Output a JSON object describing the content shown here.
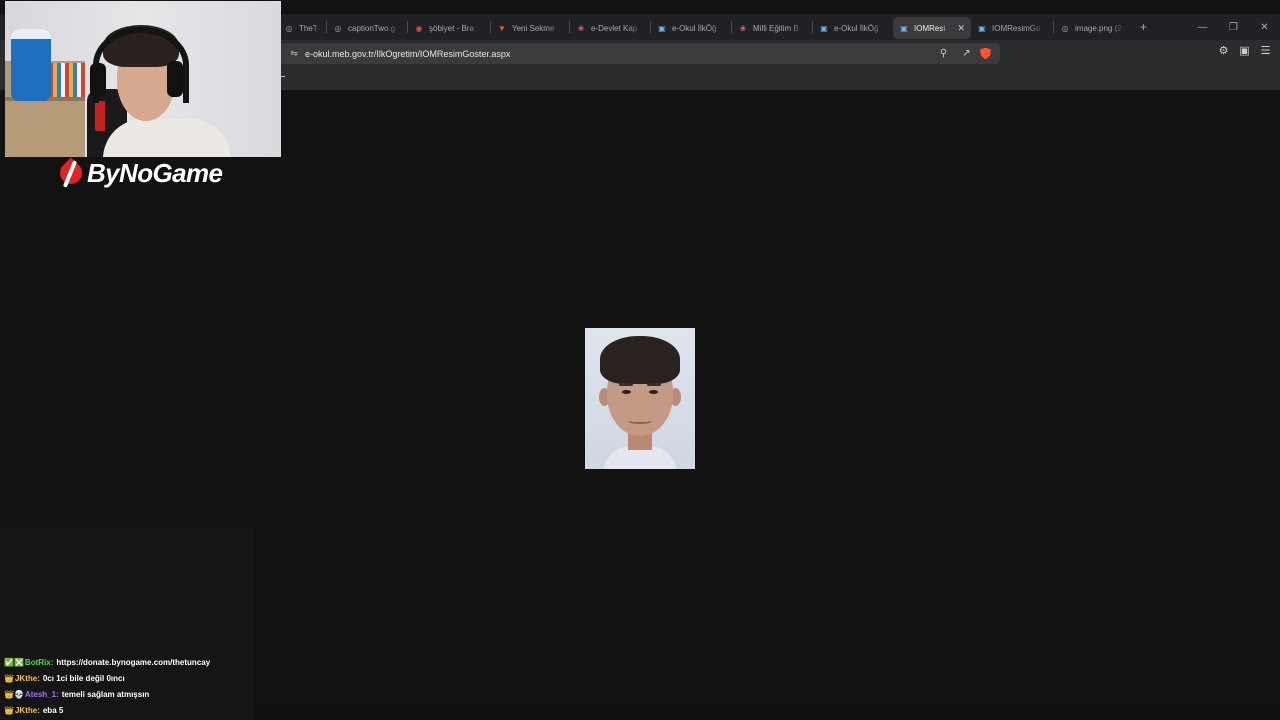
{
  "browser": {
    "tabs": [
      {
        "title": "TheTunc",
        "icon": "globe-icon",
        "active": false
      },
      {
        "title": "captionTwo.g",
        "icon": "globe-icon",
        "active": false
      },
      {
        "title": "şöbiyet - Bra",
        "icon": "search-icon",
        "active": false
      },
      {
        "title": "Yeni Sekme",
        "icon": "brave-icon",
        "active": false
      },
      {
        "title": "e-Devlet Kap",
        "icon": "edevlet-icon",
        "active": false
      },
      {
        "title": "e-Okul İlkÖğ",
        "icon": "eokul-icon",
        "active": false
      },
      {
        "title": "Milli Eğitim B",
        "icon": "edevlet-icon",
        "active": false
      },
      {
        "title": "e-Okul İlkÖğ",
        "icon": "eokul-icon",
        "active": false
      },
      {
        "title": "IOMResi",
        "icon": "eokul-icon",
        "active": true
      },
      {
        "title": "IOMResimGo",
        "icon": "eokul-icon",
        "active": false
      },
      {
        "title": "image.png (2",
        "icon": "globe-icon",
        "active": false
      }
    ],
    "url": "e-okul.meb.gov.tr/IlkOgretim/IOMResimGoster.aspx"
  },
  "overlay": {
    "brand_name": "ByNoGame",
    "chat": [
      {
        "badges": "✅❎",
        "user": "BotRix:",
        "user_color": "#58d25b",
        "message": "https://donate.bynogame.com/thetuncay"
      },
      {
        "badges": "👑",
        "user": "JKthe:",
        "user_color": "#f2c230",
        "message": "0cı 1ci bile değil 0ıncı"
      },
      {
        "badges": "👑💀",
        "user": "Atesh_1:",
        "user_color": "#a970ff",
        "message": "temeli sağlam atmışsın"
      },
      {
        "badges": "👑",
        "user": "JKthe:",
        "user_color": "#f2c230",
        "message": "eba 5"
      }
    ]
  }
}
